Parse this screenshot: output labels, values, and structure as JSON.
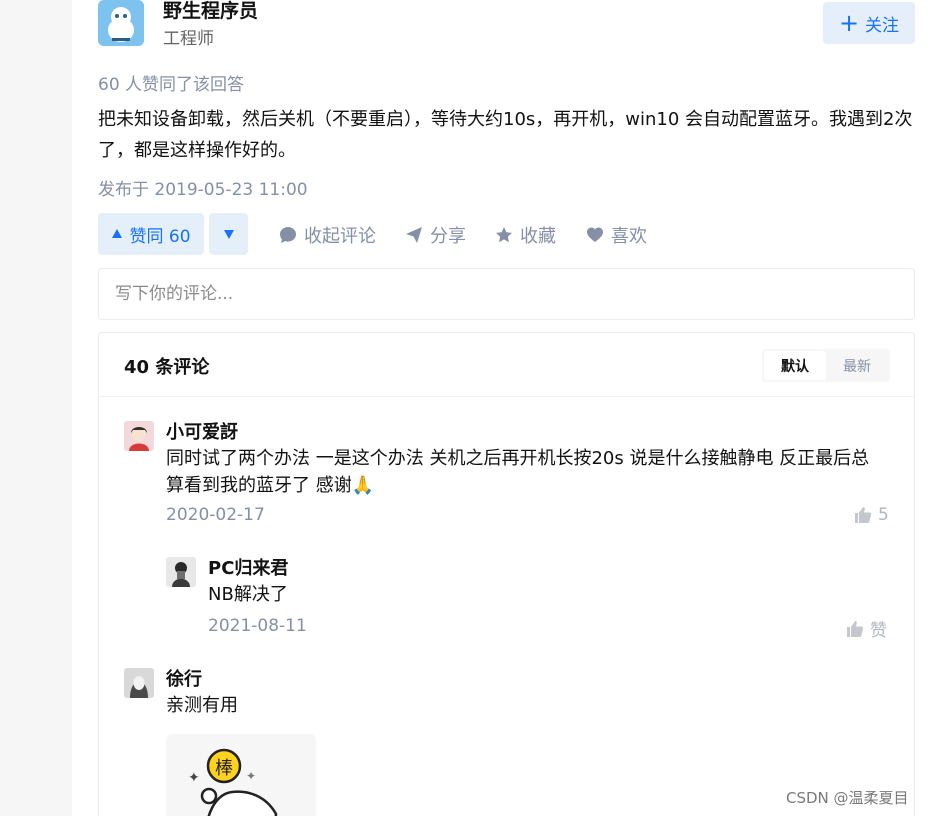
{
  "author": {
    "name": "野生程序员",
    "title": "工程师",
    "follow_label": "关注"
  },
  "answer": {
    "likes_text": "60 人赞同了该回答",
    "body": "把未知设备卸载，然后关机（不要重启），等待大约10s，再开机，win10 会自动配置蓝牙。我遇到2次了，都是这样操作好的。",
    "published": "发布于 2019-05-23 11:00"
  },
  "actions": {
    "vote_up": "赞同 60",
    "collapse_comments": "收起评论",
    "share": "分享",
    "favorite": "收藏",
    "like": "喜欢"
  },
  "comment_input": {
    "placeholder": "写下你的评论..."
  },
  "comments": {
    "count_label": "40 条评论",
    "sort": {
      "default": "默认",
      "latest": "最新"
    },
    "items": [
      {
        "name": "小可爱訝",
        "text": "同时试了两个办法 一是这个办法 关机之后再开机长按20s 说是什么接触静电 反正最后总算看到我的蓝牙了 感谢🙏",
        "date": "2020-02-17",
        "likes": "5"
      },
      {
        "name": "PC归来君",
        "text": "NB解决了",
        "date": "2021-08-11",
        "likes": "赞"
      },
      {
        "name": "徐行",
        "text": "亲测有用",
        "sticker_text": "棒"
      }
    ]
  },
  "watermark": "CSDN @温柔夏目",
  "colors": {
    "accent": "#1772f6",
    "accent_bg": "#e5effa",
    "muted": "#8590a6",
    "border": "#ebebeb"
  }
}
